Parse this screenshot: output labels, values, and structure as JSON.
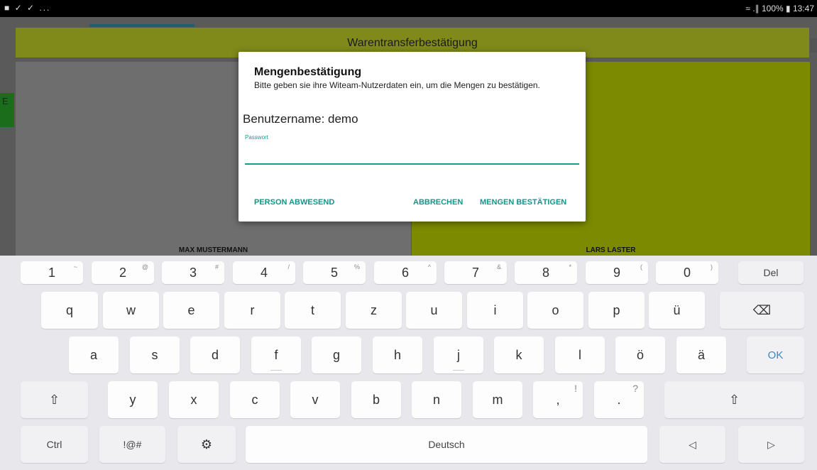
{
  "statusbar": {
    "left_icons": "■ ✓ ✓ ...",
    "right": "≈ .∥ 100% ▮ 13:47"
  },
  "app": {
    "title": "Warentransferbestätigung",
    "left_person": "MAX MUSTERMANN",
    "right_person": "LARS LASTER",
    "side_tab": "E"
  },
  "dialog": {
    "title": "Mengenbestätigung",
    "text": "Bitte geben sie ihre Witeam-Nutzerdaten ein, um die Mengen zu bestätigen.",
    "username": "Benutzername: demo",
    "password_label": "Passwort",
    "password_value": "",
    "btn_absent": "PERSON ABWESEND",
    "btn_cancel": "ABBRECHEN",
    "btn_confirm": "MENGEN BESTÄTIGEN"
  },
  "keyboard": {
    "num_keys": [
      {
        "label": "1",
        "sub": "~"
      },
      {
        "label": "2",
        "sub": "@"
      },
      {
        "label": "3",
        "sub": "#"
      },
      {
        "label": "4",
        "sub": "/"
      },
      {
        "label": "5",
        "sub": "%"
      },
      {
        "label": "6",
        "sub": "^"
      },
      {
        "label": "7",
        "sub": "&"
      },
      {
        "label": "8",
        "sub": "*"
      },
      {
        "label": "9",
        "sub": "("
      },
      {
        "label": "0",
        "sub": ")"
      }
    ],
    "del": "Del",
    "row1": [
      "q",
      "w",
      "e",
      "r",
      "t",
      "z",
      "u",
      "i",
      "o",
      "p",
      "ü"
    ],
    "backspace_icon": "⌫",
    "row2": [
      "a",
      "s",
      "d",
      "f",
      "g",
      "h",
      "j",
      "k",
      "l",
      "ö",
      "ä"
    ],
    "ok": "OK",
    "shift_icon": "⇧",
    "row3": [
      "y",
      "x",
      "c",
      "v",
      "b",
      "n",
      "m"
    ],
    "comma": ",",
    "comma_sub": "!",
    "period": ".",
    "period_sub": "?",
    "ctrl": "Ctrl",
    "symbols": "!@#",
    "settings_icon": "⚙",
    "space": "Deutsch",
    "left_icon": "◁",
    "right_icon": "▷"
  }
}
